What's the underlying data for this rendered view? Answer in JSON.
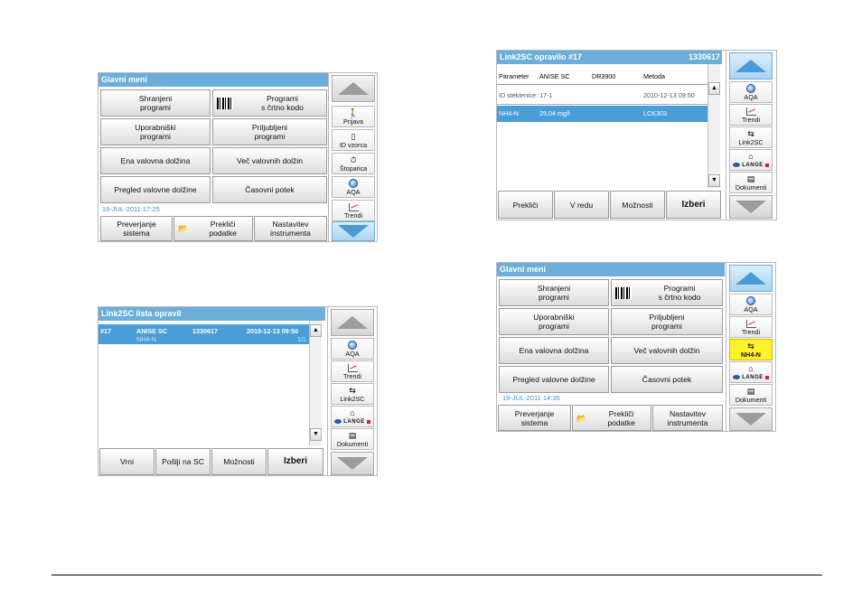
{
  "colors": {
    "title_blue": "#6aaed9",
    "selection_blue": "#4a9ed8",
    "date_blue": "#3a8ed0",
    "highlight_yellow": "#fff12b"
  },
  "screen1": {
    "title": "Glavni meni",
    "buttons": {
      "shranjeni": "Shranjeni\nprogrami",
      "crtna": "Programi\ns črtno kodo",
      "uporabniski": "Uporabniški\nprogrami",
      "priljubljeni": "Priljubljeni\nprogrami",
      "ena": "Ena valovna dolžina",
      "vec": "Več valovnih dolžin",
      "pregled": "Pregled valovne dolžine",
      "casovni": "Časovni potek"
    },
    "date": "19-JUL-2011  17:25",
    "bottom": {
      "preverjanje": "Preverjanje\nsistema",
      "preklici": "Prekliči\npodatke",
      "nastavitev": "Nastavitev\ninstrumenta"
    },
    "side": {
      "prijava": "Prijava",
      "id_vzorca": "ID vzorca",
      "stoparica": "Štoparica",
      "aqa": "AQA",
      "trendi": "Trendi"
    }
  },
  "screen2": {
    "title": "Link2SC opravilo #17",
    "title_num": "1330617",
    "head": {
      "parameter": "Parameter",
      "anise": "ANISE SC",
      "dr": "DR3900",
      "metoda": "Metoda"
    },
    "row1": {
      "id": "ID steklenice: 17-1",
      "date": "2010-12-13 09:50"
    },
    "row2": {
      "param": "NH4-N",
      "value": "25.04 mg/l",
      "method": "LCK303"
    },
    "bottom": {
      "preklici": "Prekliči",
      "vredu": "V redu",
      "moznosti": "Možnosti",
      "izberi": "Izberi"
    },
    "side": {
      "aqa": "AQA",
      "trendi": "Trendi",
      "link2sc": "Link2SC",
      "lange": "LANGE",
      "dokumenti": "Dokumenti"
    }
  },
  "screen3": {
    "title": "Link2SC lista opravil",
    "row": {
      "num": "#17",
      "name": "ANISE SC",
      "id": "1330617",
      "date": "2010-12-13 09:50",
      "param": "NH4-N",
      "page": "1/1"
    },
    "bottom": {
      "vrni": "Vrni",
      "poslji": "Pošlji na SC",
      "moznosti": "Možnosti",
      "izberi": "Izberi"
    },
    "side": {
      "aqa": "AQA",
      "trendi": "Trendi",
      "link2sc": "Link2SC",
      "lange": "LANGE",
      "dokumenti": "Dokumenti"
    }
  },
  "screen4": {
    "title": "Glavni meni",
    "buttons": {
      "shranjeni": "Shranjeni\nprogrami",
      "crtna": "Programi\ns črtno kodo",
      "uporabniski": "Uporabniški\nprogrami",
      "priljubljeni": "Priljubljeni\nprogrami",
      "ena": "Ena valovna dolžina",
      "vec": "Več valovnih dolžin",
      "pregled": "Pregled valovne dolžine",
      "casovni": "Časovni potek"
    },
    "date": "19-JUL-2011  14:35",
    "bottom": {
      "preverjanje": "Preverjanje\nsistema",
      "preklici": "Prekliči\npodatke",
      "nastavitev": "Nastavitev\ninstrumenta"
    },
    "side": {
      "aqa": "AQA",
      "trendi": "Trendi",
      "nh4n": "NH4-N",
      "lange": "LANGE",
      "dokumenti": "Dokumenti"
    }
  }
}
